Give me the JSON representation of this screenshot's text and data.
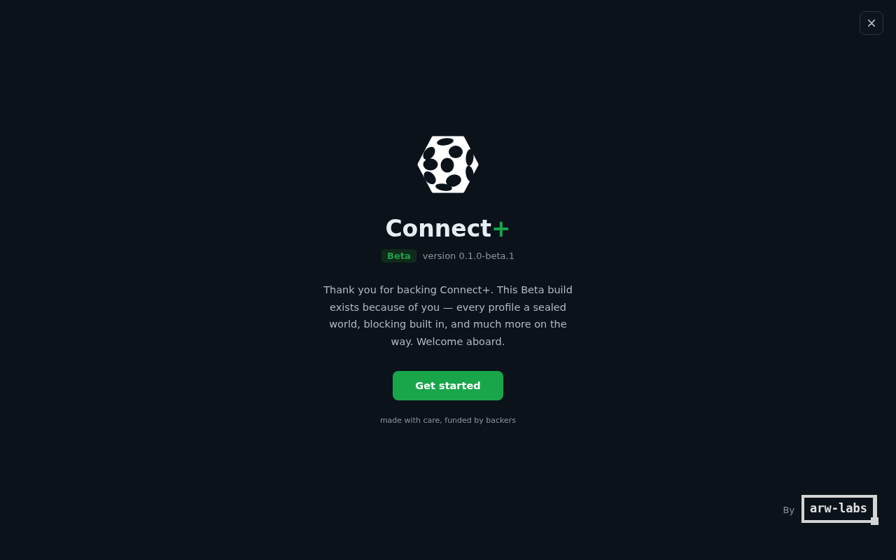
{
  "app": {
    "name": "Connect",
    "accent": "+"
  },
  "badge": "Beta",
  "version": "version 0.1.0-beta.1",
  "message": "Thank you for backing Connect+. This Beta build exists because of you — every profile a sealed world, blocking built in, and much more on the way. Welcome aboard.",
  "primary_button": "Get started",
  "footnote": "made with care, funded by backers",
  "credit": {
    "prefix": "By",
    "logo": "arw-labs"
  }
}
